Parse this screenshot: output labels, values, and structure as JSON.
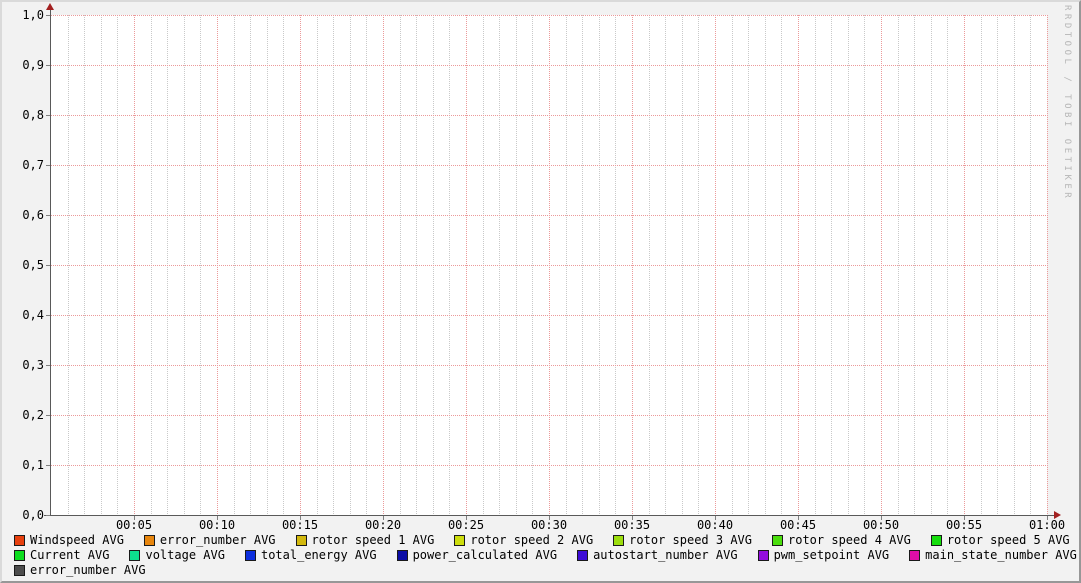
{
  "watermark": "RRDTOOL / TOBI OETIKER",
  "chart_data": {
    "type": "line",
    "title": "",
    "series": [],
    "note": "empty graph area - no data lines plotted, only grid",
    "x_axis": {
      "tick_labels": [
        "00:05",
        "00:10",
        "00:15",
        "00:20",
        "00:25",
        "00:30",
        "00:35",
        "00:40",
        "00:45",
        "00:50",
        "00:55",
        "01:00"
      ],
      "minutes_total": 60,
      "major_step_minutes": 5,
      "minor_step_minutes": 1
    },
    "y_axis": {
      "tick_labels": [
        "1,0",
        "0,9",
        "0,8",
        "0,7",
        "0,6",
        "0,5",
        "0,4",
        "0,3",
        "0,2",
        "0,1",
        "0,0"
      ],
      "min": 0.0,
      "max": 1.0,
      "major_step": 0.1
    },
    "grid": {
      "major_color": "#EB9A9A",
      "minor_color": "#C9C9C9",
      "axis_color": "#595959",
      "arrow_color": "#A32020",
      "canvas_color": "#FFFFFF",
      "background_color": "#F2F2F2"
    },
    "legend_rows": [
      [
        {
          "label": "Windspeed AVG",
          "color": "#E7400E"
        },
        {
          "label": "error_number AVG",
          "color": "#E8860D"
        },
        {
          "label": "rotor speed 1 AVG",
          "color": "#D3B90E"
        },
        {
          "label": "rotor speed 2 AVG",
          "color": "#CEDE0D"
        },
        {
          "label": "rotor speed 3 AVG",
          "color": "#9CDE0D"
        },
        {
          "label": "rotor speed 4 AVG",
          "color": "#4BDE0D"
        },
        {
          "label": "rotor speed 5 AVG",
          "color": "#16DE0D"
        }
      ],
      [
        {
          "label": "Current AVG",
          "color": "#0DDE1F"
        },
        {
          "label": "voltage AVG",
          "color": "#0DDE8D"
        },
        {
          "label": "total_energy AVG",
          "color": "#0D2FDE"
        },
        {
          "label": "power_calculated AVG",
          "color": "#0C0DA6"
        },
        {
          "label": "autostart_number AVG",
          "color": "#3D0CD6"
        },
        {
          "label": "pwm_setpoint AVG",
          "color": "#930DDE"
        },
        {
          "label": "main_state_number AVG",
          "color": "#DE0DA8"
        }
      ],
      [
        {
          "label": "error_number AVG",
          "color": "#4D4D4D"
        }
      ]
    ]
  }
}
